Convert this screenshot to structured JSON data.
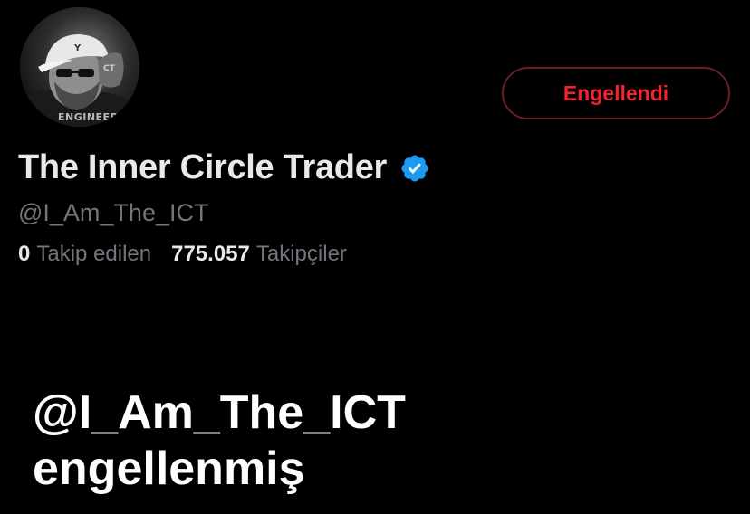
{
  "profile": {
    "avatar_icon": "profile-photo",
    "avatar_watermark": "ENGINEER",
    "display_name": "The Inner Circle Trader",
    "verified_icon": "verified-badge-icon",
    "handle": "@I_Am_The_ICT",
    "following_count": "0",
    "following_label": "Takip edilen",
    "followers_count": "775.057",
    "followers_label": "Takipçiler"
  },
  "actions": {
    "blocked_label": "Engellendi"
  },
  "caption": {
    "line1": "@I_Am_The_ICT",
    "line2": "engellenmiş"
  },
  "colors": {
    "background": "#000000",
    "primary_text": "#e7e9ea",
    "secondary_text": "#71767b",
    "blocked_red": "#f4212e",
    "blocked_border": "#6b1f1f",
    "verified_blue": "#1d9bf0",
    "caption_text": "#ffffff"
  }
}
